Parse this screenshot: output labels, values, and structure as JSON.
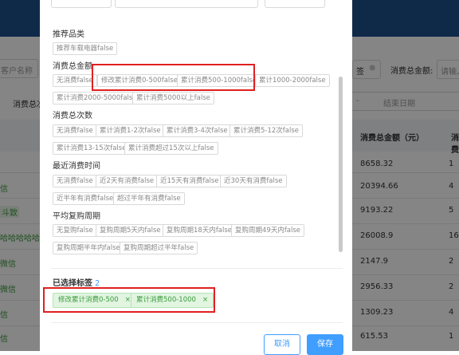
{
  "background": {
    "customer_name_placeholder": "客户名称",
    "consumption_total_label": "消费总金额:",
    "consumption_total_placeholder": "请输入",
    "tag_select": "签",
    "left_cut_label": "消费总次",
    "end_date_placeholder": "结束日期",
    "date_separator": "-",
    "table_header_amount": "消费总金额（元）",
    "table_header_count": "消费",
    "rows": [
      {
        "name": "",
        "amount": "8658.32",
        "count": "1"
      },
      {
        "name": "信",
        "amount": "20394.66",
        "count": "4"
      },
      {
        "name": "斗致",
        "amount": "9193.22",
        "count": "5"
      },
      {
        "name": "哈哈哈哈哈...",
        "amount": "26008.9",
        "count": "16"
      },
      {
        "name": "微信",
        "amount": "2147.9",
        "count": "2"
      },
      {
        "name": "微信",
        "amount": "2956.33",
        "count": "2"
      },
      {
        "name": "信",
        "amount": "1309.23",
        "count": "4"
      },
      {
        "name": "信",
        "amount": "615.53",
        "count": "1"
      }
    ]
  },
  "modal": {
    "sections": [
      {
        "title": "推荐品类",
        "tags": [
          "推荐车载电器false"
        ]
      },
      {
        "title": "消费总金额",
        "tags": [
          "无消费false",
          "修改累计消费0-500false",
          "累计消费500-1000false",
          "累计1000-2000false",
          "累计消费2000-5000false",
          "累计消费5000以上false"
        ]
      },
      {
        "title": "消费总次数",
        "tags": [
          "无消费false",
          "累计消费1-2次false",
          "累计消费3-4次false",
          "累计消费5-12次false",
          "累计消费13-15次false",
          "累计消费超过15次以上false"
        ]
      },
      {
        "title": "最近消费时间",
        "tags": [
          "无消费false",
          "近2天有消费false",
          "近15天有消费false",
          "近30天有消费false",
          "近半年有消费false",
          "超过半年有消费false"
        ]
      },
      {
        "title": "平均复购周期",
        "tags": [
          "无复购false",
          "复购周期5天内false",
          "复购周期18天内false",
          "复购周期49天内false",
          "复购周期半年内false",
          "复购周期超过半年false"
        ]
      }
    ],
    "selected_title": "已选择标签",
    "selected_count": "2",
    "selected_tags": [
      "修改累计消费0-500",
      "累计消费500-1000"
    ],
    "close_glyph": "×",
    "cancel_label": "取消",
    "save_label": "保存"
  },
  "colors": {
    "primary": "#409eff",
    "highlight": "#e02020",
    "selected_tag_bg": "#e1f5e1",
    "selected_tag_text": "#3c9a3c"
  }
}
